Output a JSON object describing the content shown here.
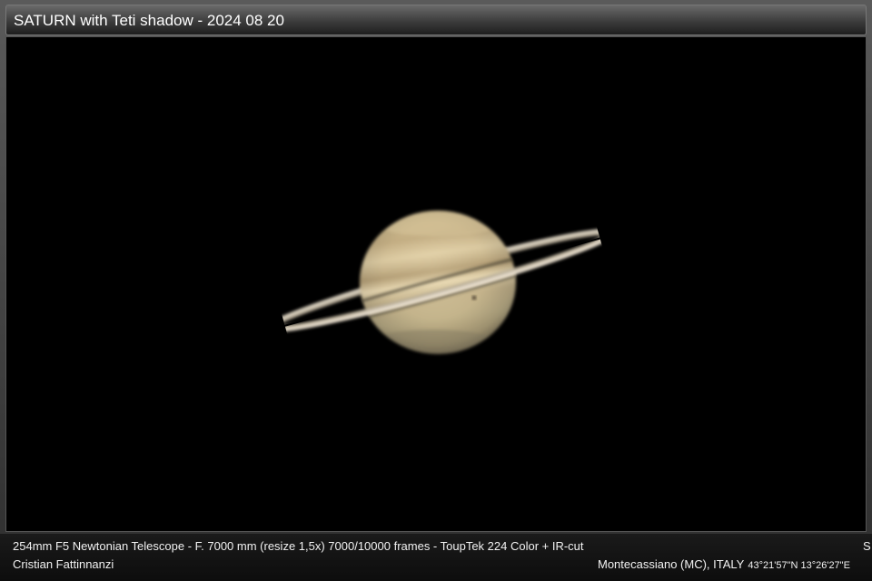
{
  "title": "SATURN with Teti shadow - 2024 08 20",
  "image": {
    "subject": "saturn-icon",
    "background_color": "#000000"
  },
  "footer": {
    "equipment": "254mm F5 Newtonian Telescope - F. 7000 mm (resize 1,5x)  7000/10000 frames - ToupTek 224 Color + IR-cut",
    "cut_letter": "S",
    "author": "Cristian Fattinnanzi",
    "location": "Montecassiano (MC), ITALY",
    "coordinates": "43°21'57\"N 13°26'27\"E"
  }
}
